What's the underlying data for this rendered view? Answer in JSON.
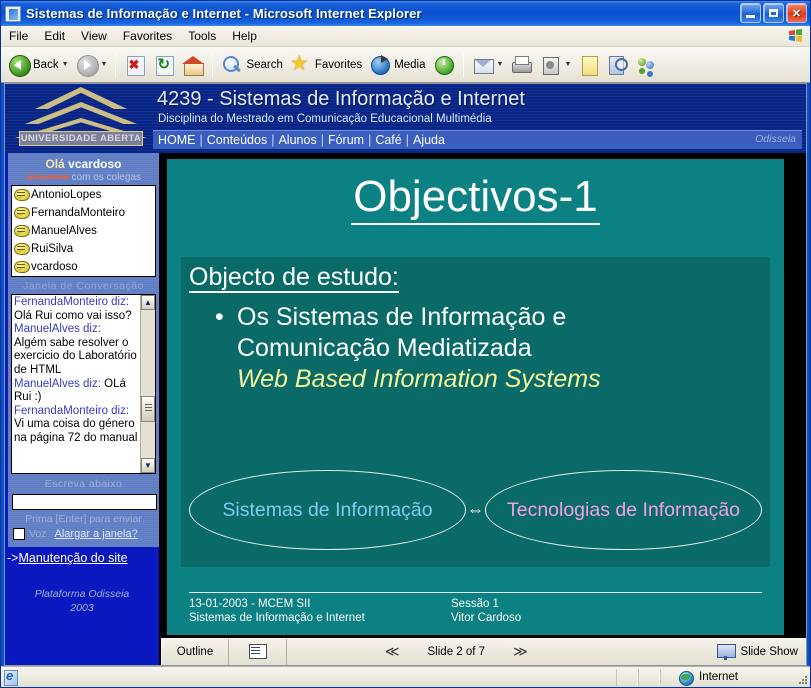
{
  "window": {
    "title": "Sistemas de Informação e Internet - Microsoft Internet Explorer",
    "minimize_label": "Minimize",
    "maximize_label": "Maximize",
    "close_label": "Close"
  },
  "menu": [
    "File",
    "Edit",
    "View",
    "Favorites",
    "Tools",
    "Help"
  ],
  "toolbar": {
    "back": "Back",
    "forward": "",
    "stop": "",
    "refresh": "",
    "home": "",
    "search": "Search",
    "favorites": "Favorites",
    "media": "Media",
    "history": "",
    "mail": "",
    "print": "",
    "edit": "",
    "note": "",
    "research": "",
    "messenger": ""
  },
  "site": {
    "logo_text": "UNIVERSIDADE ABERTA",
    "title": "4239 - Sistemas de Informação e Internet",
    "subtitle": "Disciplina do Mestrado em Comunicação Educacional Multimédia",
    "nav": [
      "HOME",
      "Conteúdos",
      "Alunos",
      "Fórum",
      "Café",
      "Ajuda"
    ],
    "nav_separator": "|",
    "brand_right": "Odisseia"
  },
  "sidebar": {
    "greeting_prefix": "Olá",
    "greeting_user": "vcardoso",
    "subtitle_link": "Converse",
    "subtitle_rest": "com os colegas",
    "users": [
      "AntonioLopes",
      "FernandaMonteiro",
      "ManuelAlves",
      "RuiSilva",
      "vcardoso"
    ],
    "chat_window_title": "Janela de Conversação",
    "messages": [
      {
        "who": "FernandaMonteiro diz:",
        "text": "Olá Rui como vai isso?"
      },
      {
        "who": "ManuelAlves diz:",
        "text": "Algém sabe resolver o exercicio do Laboratório de HTML"
      },
      {
        "who": "ManuelAlves diz:",
        "text": "OLá Rui :)"
      },
      {
        "who": "FernandaMonteiro diz:",
        "text": "Vi uma coisa do género na página 72 do manual"
      }
    ],
    "input_label": "Escreva abaixo",
    "input_value": "",
    "input_hint": "Prima [Enter] para enviar",
    "voice_label": "Voz",
    "voice_checked": false,
    "enlarge_link": "Alargar a janela?",
    "maintenance_arrow": "->",
    "maintenance_link": "Manutenção do site",
    "platform_line1": "Plataforma Odisseia",
    "platform_line2": "2003"
  },
  "slide": {
    "title": "Objectivos-1",
    "heading": "Objecto de estudo:",
    "bullet_dot": "•",
    "bullet_line1": "Os Sistemas de Informação e",
    "bullet_line2": "Comunicação Mediatizada",
    "bullet_emphasis": "Web Based Information Systems",
    "ellipse_left": "Sistemas de Informação",
    "ellipse_arrow": "⇔",
    "ellipse_right": "Tecnologias de Informação",
    "footer_date": "13-01-2003 - MCEM SII",
    "footer_course": "Sistemas de Informação e Internet",
    "footer_session": "Sessão 1",
    "footer_author": "Vitor Cardoso",
    "colors": {
      "slide_bg": "#0b8183",
      "content_bg": "#0a6a67",
      "title_text": "#ffffff",
      "emphasis_text": "#f4f49a",
      "ellipse_left_text": "#82c8f0",
      "ellipse_right_text": "#f0a0e8"
    }
  },
  "controls": {
    "outline_label": "Outline",
    "view_icon": "slide-view-icon",
    "prev_label": "≪",
    "slide_counter": "Slide 2 of 7",
    "next_label": "≫",
    "slideshow_label": "Slide Show"
  },
  "status": {
    "text": "",
    "zone": "Internet"
  }
}
